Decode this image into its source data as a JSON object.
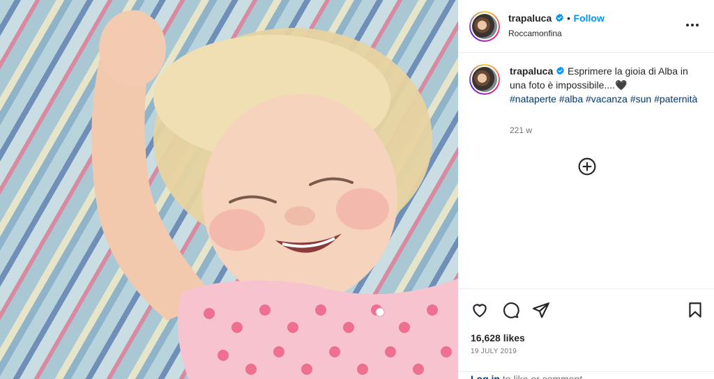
{
  "post": {
    "image_alt": "Smiling blonde toddler in a pink polka-dot dress lying on a striped blanket",
    "author": {
      "username": "trapaluca",
      "location": "Roccamonfina",
      "verified": true,
      "follow_label": "Follow",
      "separator": "•"
    },
    "caption": {
      "username": "trapaluca",
      "text": "Esprimere la gioia di Alba in una foto è impossibile....🖤",
      "hashtags": [
        "#nataperte",
        "#alba",
        "#vacanza",
        "#sun",
        "#paternità"
      ],
      "time_ago": "221 w"
    },
    "likes": "16,628 likes",
    "date": "19 JULY 2019",
    "login_prompt": {
      "link": "Log in",
      "text": " to like or comment."
    },
    "icons": {
      "more": "more-options-icon",
      "add_comment": "plus-circle-icon",
      "like": "heart-icon",
      "comment": "comment-icon",
      "share": "share-icon",
      "save": "bookmark-icon",
      "verified": "verified-badge-icon"
    },
    "colors": {
      "follow": "#0095f6",
      "verified": "#0095f6",
      "hashtag": "#00376b",
      "muted": "#737373"
    }
  }
}
